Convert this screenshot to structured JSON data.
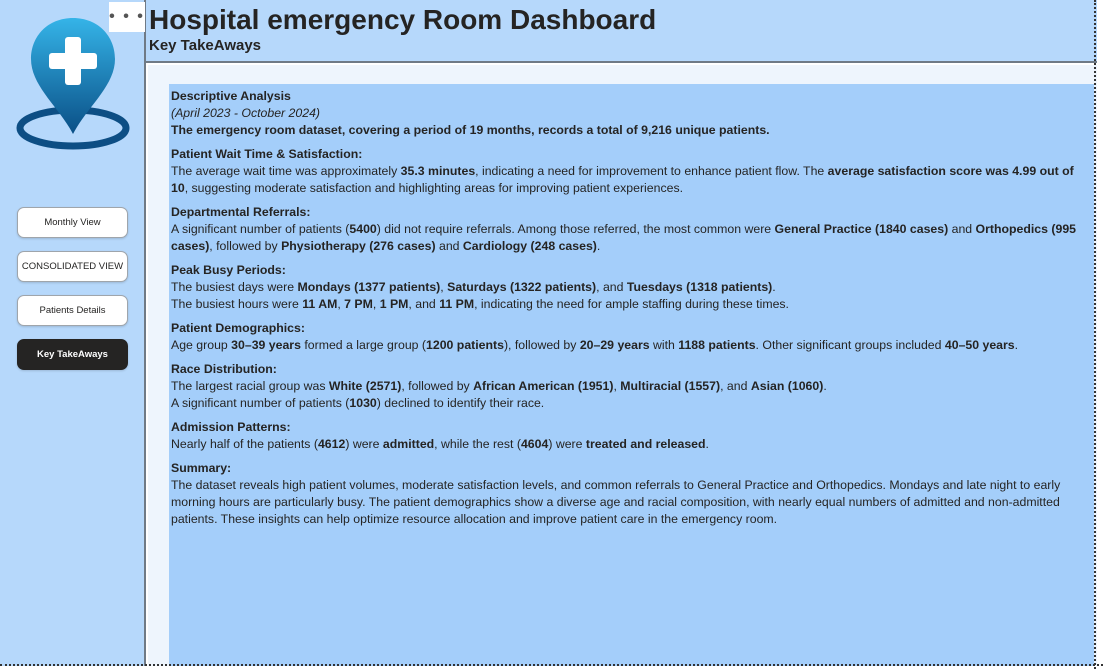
{
  "sidebar": {
    "more_label": "• • •",
    "logo_icon": "hospital-location-pin-icon",
    "nav": [
      {
        "label": "Monthly View"
      },
      {
        "label": "CONSOLIDATED VIEW"
      },
      {
        "label": "Patients Details"
      },
      {
        "label": "Key TakeAways"
      }
    ]
  },
  "header": {
    "title": "Hospital emergency Room Dashboard",
    "subtitle": "Key TakeAways"
  },
  "content": {
    "heading": "Descriptive Analysis",
    "period": "(April 2023 - October 2024)",
    "overview": "The emergency room dataset, covering a period of 19 months, records a total of 9,216 unique patients.",
    "wait": {
      "title": "Patient Wait Time & Satisfaction:",
      "t1": "The average wait time was approximately ",
      "b1": "35.3 minutes",
      "t2": ", indicating a need for improvement to enhance patient flow. The ",
      "b2": "average satisfaction score was 4.99 out of 10",
      "t3": ", suggesting moderate satisfaction and highlighting areas for improving patient experiences."
    },
    "referrals": {
      "title": "Departmental Referrals:",
      "t1": "A significant number of patients (",
      "b1": "5400",
      "t2": ") did not require referrals. Among those referred, the most common were ",
      "b2": "General Practice (1840 cases)",
      "t3": " and ",
      "b3": "Orthopedics (995 cases)",
      "t4": ", followed by ",
      "b4": "Physiotherapy (276 cases)",
      "t5": " and ",
      "b5": "Cardiology (248 cases)",
      "t6": "."
    },
    "peak": {
      "title": "Peak Busy Periods:",
      "l1_t1": "The busiest days were ",
      "l1_b1": "Mondays (1377 patients)",
      "l1_t2": ", ",
      "l1_b2": "Saturdays (1322 patients)",
      "l1_t3": ", and ",
      "l1_b3": "Tuesdays (1318 patients)",
      "l1_t4": ".",
      "l2_t1": "The busiest hours were ",
      "l2_b1": "11 AM",
      "l2_t2": ", ",
      "l2_b2": "7 PM",
      "l2_t3": ", ",
      "l2_b3": "1 PM",
      "l2_t4": ", and ",
      "l2_b4": "11 PM",
      "l2_t5": ", indicating the need for ample staffing during these times."
    },
    "demographics": {
      "title": "Patient Demographics:",
      "t1": "Age group ",
      "b1": "30–39 years",
      "t2": " formed a large group (",
      "b2": "1200 patients",
      "t3": "), followed by ",
      "b3": "20–29 years",
      "t4": " with ",
      "b4": "1188 patients",
      "t5": ". Other significant groups included ",
      "b5": "40–50 years",
      "t6": "."
    },
    "race": {
      "title": "Race Distribution:",
      "l1_t1": "The largest racial group was ",
      "l1_b1": "White (2571)",
      "l1_t2": ", followed by ",
      "l1_b2": "African American (1951)",
      "l1_t3": ", ",
      "l1_b3": "Multiracial (1557)",
      "l1_t4": ", and ",
      "l1_b4": "Asian (1060)",
      "l1_t5": ".",
      "l2_t1": "A significant number of patients (",
      "l2_b1": "1030",
      "l2_t2": ") declined to identify their race."
    },
    "admission": {
      "title": "Admission Patterns:",
      "t1": "Nearly half of the patients (",
      "b1": "4612",
      "t2": ") were ",
      "b2": "admitted",
      "t3": ", while the rest (",
      "b3": "4604",
      "t4": ") were ",
      "b4": "treated and released",
      "t5": "."
    },
    "summary": {
      "title": "Summary:",
      "text": "The dataset reveals high patient volumes, moderate satisfaction levels, and common referrals to General Practice and Orthopedics. Mondays and late night to early morning hours are particularly busy. The patient demographics show a diverse age and racial composition, with nearly equal numbers of admitted and non-admitted patients. These insights can help optimize resource allocation and improve patient care in the emergency room."
    }
  },
  "colors": {
    "panel": "#b6d8fb",
    "content": "#a4cefa",
    "active_button": "#252423",
    "logo_blue": "#1a86c7"
  }
}
